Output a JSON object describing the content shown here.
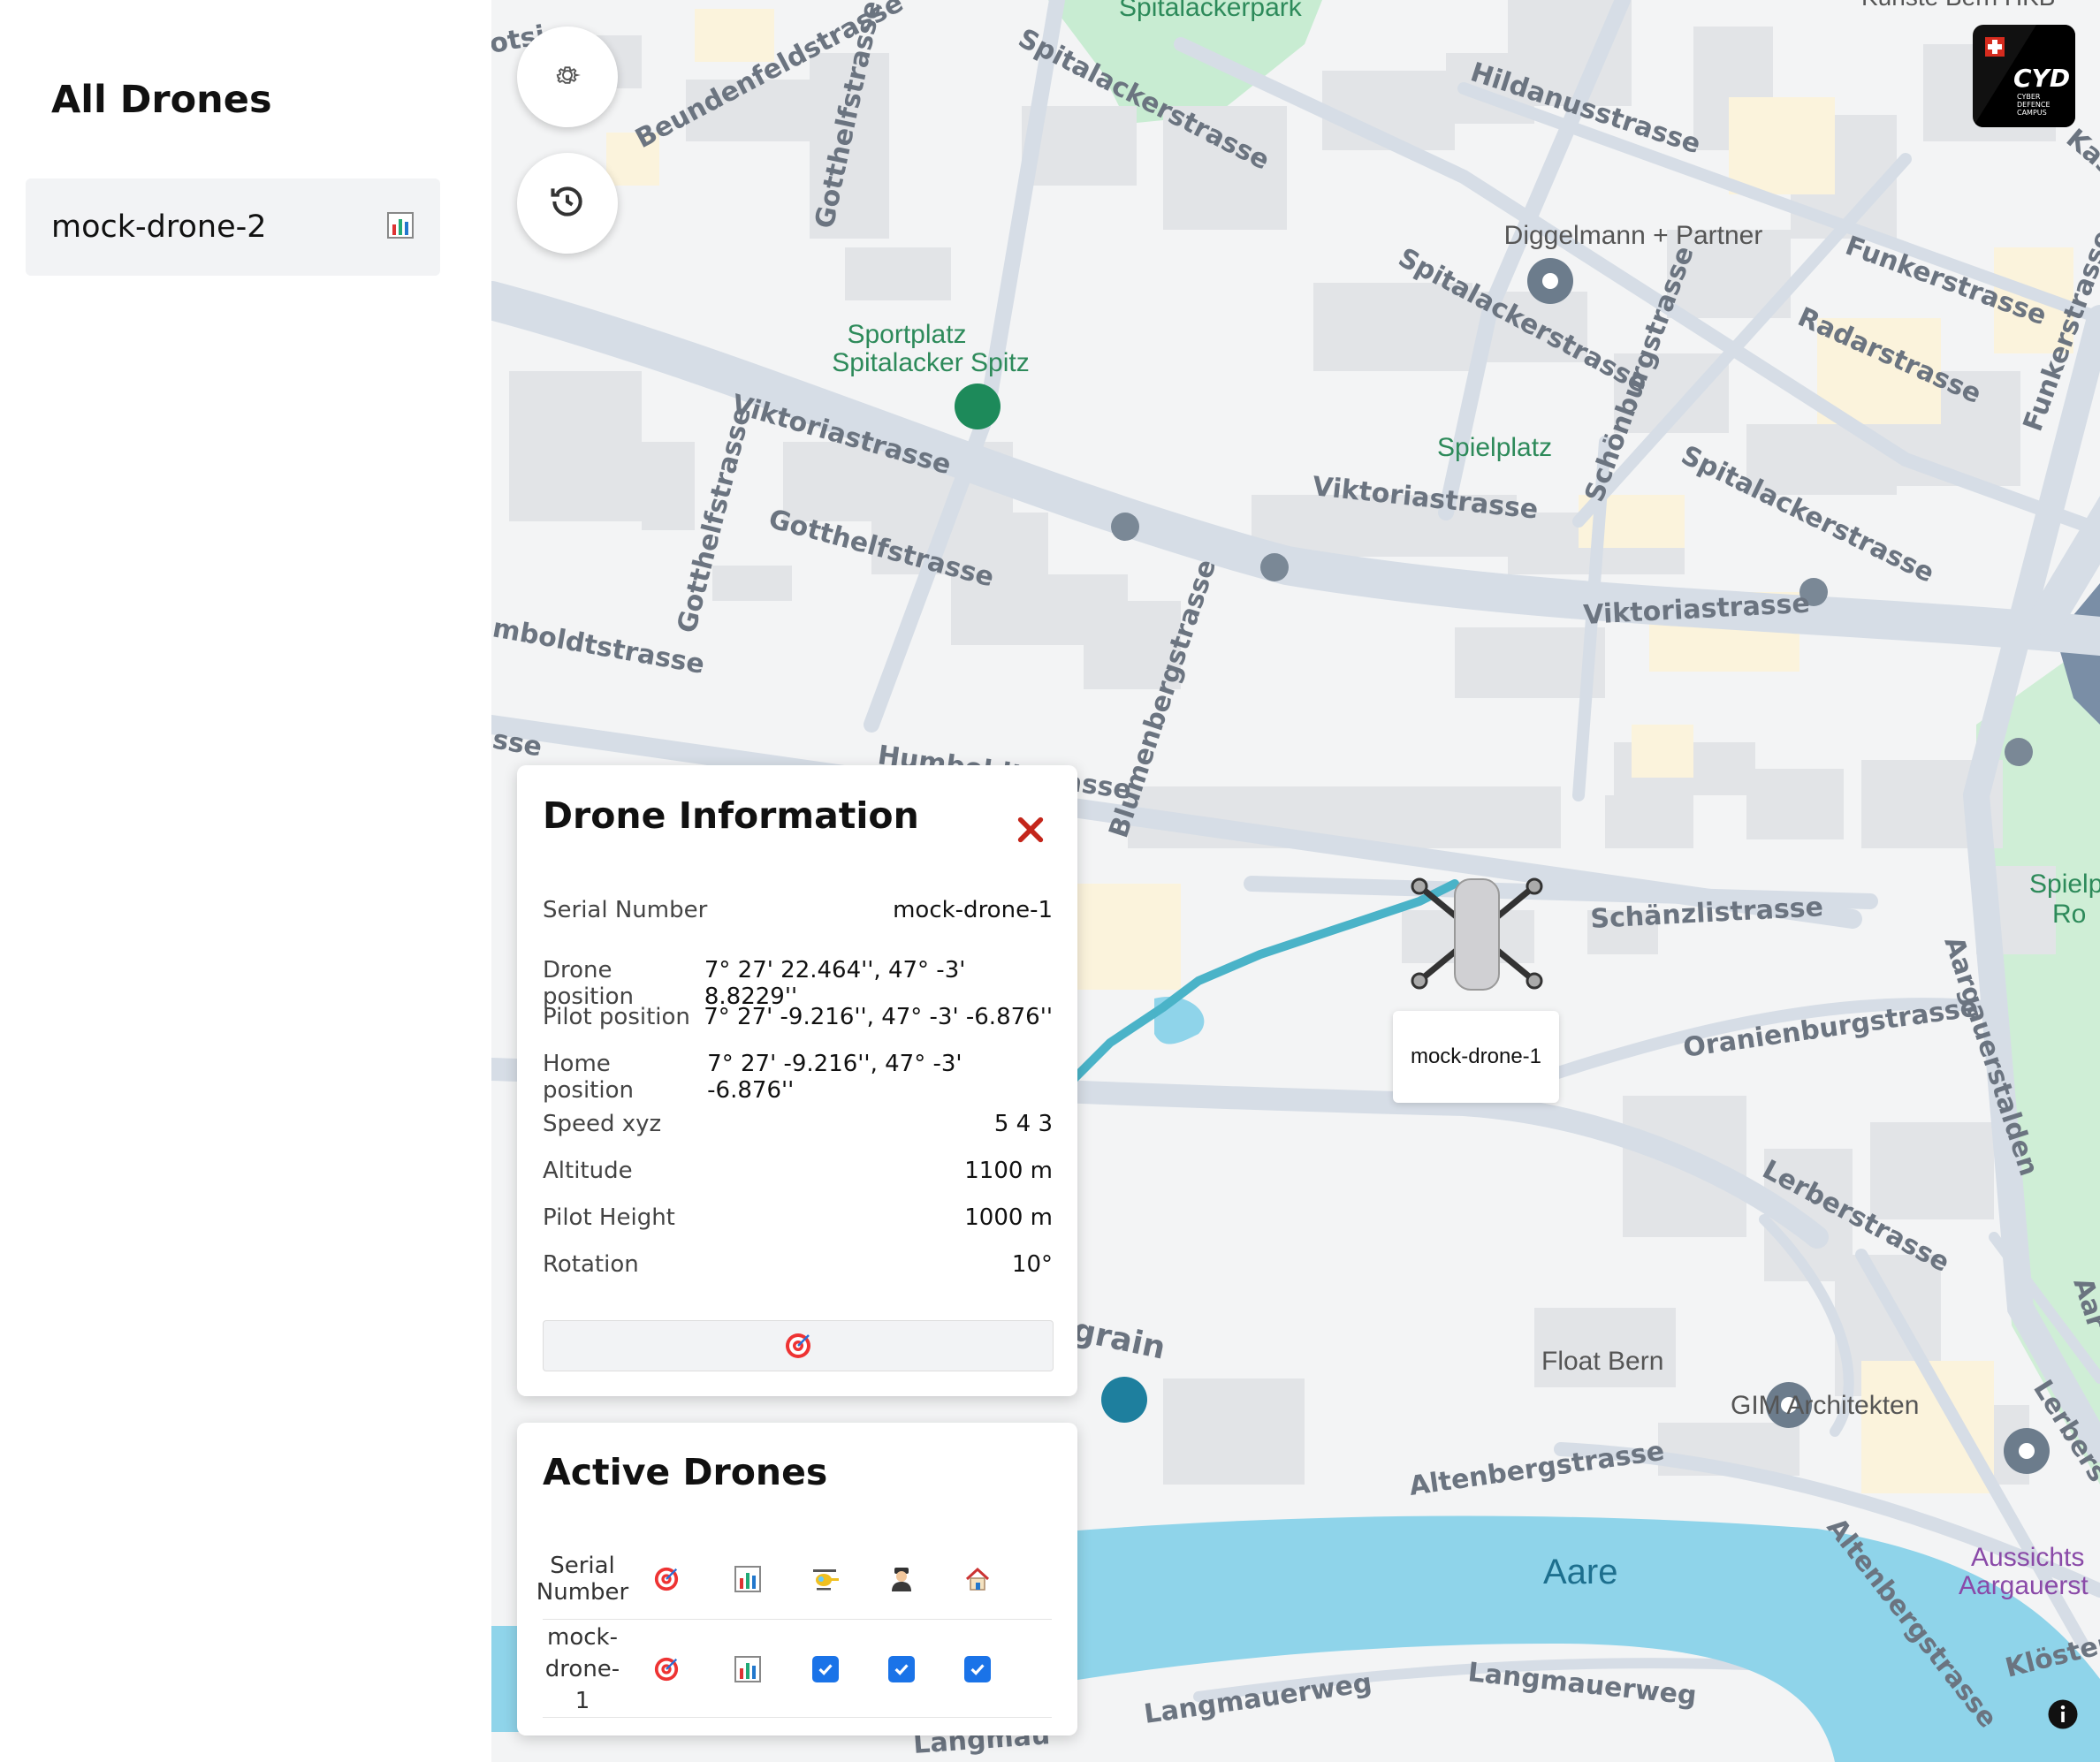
{
  "sidebar": {
    "title": "All Drones",
    "items": [
      {
        "label": "mock-drone-2",
        "icon": "bar-chart-icon"
      }
    ]
  },
  "map_controls": {
    "settings_icon": "gear-icon",
    "history_icon": "history-icon"
  },
  "logo": {
    "text": "CYD",
    "subtext_1": "CYBER",
    "subtext_2": "DEFENCE",
    "subtext_3": "CAMPUS"
  },
  "map_labels": {
    "park": "Spitalackerpark",
    "sport_1": "Sportplatz",
    "sport_2": "Spitalacker Spitz",
    "diggelmann": "Diggelmann + Partner",
    "spielplatz": "Spielplatz",
    "float": "Float Bern",
    "gim": "GIM Architekten",
    "aare": "Aare",
    "aussicht_1": "Aussichts",
    "aussicht_2": "Aargauerst",
    "spielp_1": "Spielp",
    "spielp_2": "Ro",
    "kunste": "Kunste Bern HKB",
    "streets": {
      "beundenfeld": "Beundenfeldstrasse",
      "spitalacker_1": "Spitalackerstrasse",
      "spitalacker_2": "Spitalackerstrasse",
      "spitalacker_3": "Spitalackerstrasse",
      "hildanus": "Hildanusstrasse",
      "gotthelf_1": "Gotthelfstrasse",
      "gotthelf_2": "Gotthelfstrasse",
      "gotthelf_3": "Gotthelfstrasse",
      "viktoria_1": "Viktoriastrasse",
      "viktoria_2": "Viktoriastrasse",
      "viktoria_3": "Viktoriastrasse",
      "funker_1": "Funkerstrasse",
      "funker_2": "Funkerstrasse",
      "radar": "Radarstrasse",
      "schoenburg": "Schönburgstrasse",
      "humboldt_1": "mboldtstrasse",
      "humboldt_2": "Humboldtstrasse",
      "blumenberg": "Blumenbergstrasse",
      "schaenzli": "Schänzlistrasse",
      "oranienburg": "Oranienburgstrasse",
      "aargauerstalden": "Aargauerstalden",
      "lerber_1": "Lerberstrasse",
      "lerber_2": "Lerbers",
      "altenberg_1": "Altenbergstrasse",
      "altenberg_2": "Altenbergstrasse",
      "langmauer_1": "Langmauerweg",
      "langmauer_2": "Langmauerweg",
      "langmauer_3": "Langmau",
      "kloester": "Klöster",
      "grain": "grain",
      "sse_1": "sse",
      "otsi": "otsi",
      "kas": "Kas",
      "aar": "Aar"
    }
  },
  "drone_marker": {
    "label": "mock-drone-1"
  },
  "drone_info": {
    "title": "Drone Information",
    "rows": [
      {
        "key": "Serial Number",
        "value": "mock-drone-1"
      },
      {
        "key": "Drone position",
        "value": "7° 27' 22.464'', 47° -3' 8.8229''"
      },
      {
        "key": "Pilot position",
        "value": "7° 27' -9.216'', 47° -3' -6.876''"
      },
      {
        "key": "Home position",
        "value": "7° 27' -9.216'', 47° -3' -6.876''"
      },
      {
        "key": "Speed xyz",
        "value": "5 4 3"
      },
      {
        "key": "Altitude",
        "value": "1100 m"
      },
      {
        "key": "Pilot Height",
        "value": "1000 m"
      },
      {
        "key": "Rotation",
        "value": "10°"
      }
    ],
    "action_icon": "target-icon"
  },
  "active_drones": {
    "title": "Active Drones",
    "header": {
      "serial_1": "Serial",
      "serial_2": "Number"
    },
    "header_icons": [
      "target-icon",
      "bar-chart-icon",
      "helicopter-icon",
      "pilot-icon",
      "home-icon"
    ],
    "rows": [
      {
        "serial_1": "mock-",
        "serial_2": "drone-1",
        "show_drone": true,
        "show_pilot": true,
        "show_home": true
      }
    ]
  },
  "colors": {
    "map_bg": "#f3f4f5",
    "water": "#8fd4ea",
    "route": "#4ab3c8",
    "checkbox": "#1a73e8",
    "park": "#c8ecd2",
    "poi_green": "#1d8a5a"
  }
}
